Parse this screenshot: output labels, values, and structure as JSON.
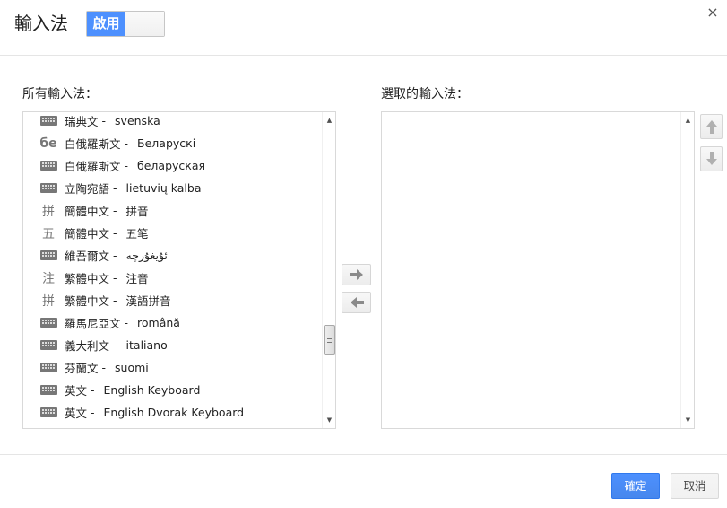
{
  "header": {
    "title": "輸入法",
    "toggle_label": "啟用",
    "close_glyph": "×"
  },
  "left_panel": {
    "label": "所有輸入法：",
    "items": [
      {
        "icon": "keyboard",
        "name": "瑞典文",
        "native": "svenska"
      },
      {
        "icon": "text",
        "icon_text": "бe",
        "name": "白俄羅斯文",
        "native": "Беларускі"
      },
      {
        "icon": "keyboard",
        "name": "白俄羅斯文",
        "native": "беларуская"
      },
      {
        "icon": "keyboard",
        "name": "立陶宛語",
        "native": "lietuvių kalba"
      },
      {
        "icon": "text",
        "icon_text": "拼",
        "name": "簡體中文",
        "native": "拼音"
      },
      {
        "icon": "text",
        "icon_text": "五",
        "name": "簡體中文",
        "native": "五笔"
      },
      {
        "icon": "keyboard",
        "name": "維吾爾文",
        "native": "ئۇيغۇرچە"
      },
      {
        "icon": "text",
        "icon_text": "注",
        "name": "繁體中文",
        "native": "注音"
      },
      {
        "icon": "text",
        "icon_text": "拼",
        "name": "繁體中文",
        "native": "漢語拼音"
      },
      {
        "icon": "keyboard",
        "name": "羅馬尼亞文",
        "native": "română"
      },
      {
        "icon": "keyboard",
        "name": "義大利文",
        "native": "italiano"
      },
      {
        "icon": "keyboard",
        "name": "芬蘭文",
        "native": "suomi"
      },
      {
        "icon": "keyboard",
        "name": "英文",
        "native": "English Keyboard"
      },
      {
        "icon": "keyboard",
        "name": "英文",
        "native": "English Dvorak Keyboard"
      },
      {
        "icon": "keyboard",
        "name": "",
        "native": ""
      }
    ],
    "separator": "-"
  },
  "right_panel": {
    "label": "選取的輸入法：",
    "items": []
  },
  "footer": {
    "ok_label": "確定",
    "cancel_label": "取消"
  },
  "colors": {
    "accent": "#4d90fe",
    "accent_border": "#3079ed",
    "icon_gray": "#777777"
  }
}
